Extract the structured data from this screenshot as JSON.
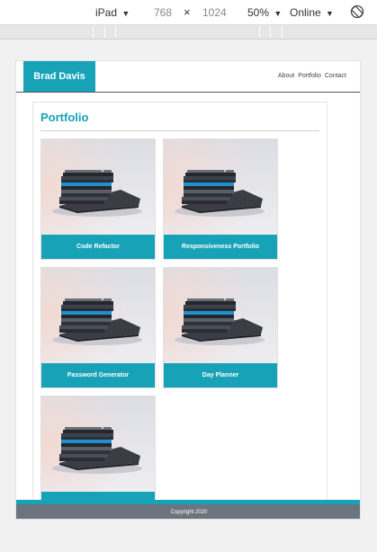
{
  "devtools": {
    "device": "iPad",
    "width": "768",
    "times": "×",
    "height": "1024",
    "zoom": "50%",
    "network": "Online",
    "caret": "▼"
  },
  "site": {
    "brand": "Brad Davis",
    "nav": [
      "About",
      "Portfolio",
      "Contact"
    ],
    "section_title": "Portfolio",
    "projects": [
      "Code Refactor",
      "Responsiveness Portfolio",
      "Password Generator",
      "Day Planner",
      ""
    ],
    "footer": "Copyright 2020"
  },
  "colors": {
    "accent": "#17a2b8",
    "footer": "#6c757d"
  },
  "icons": {
    "rotate": "rotate-icon"
  }
}
